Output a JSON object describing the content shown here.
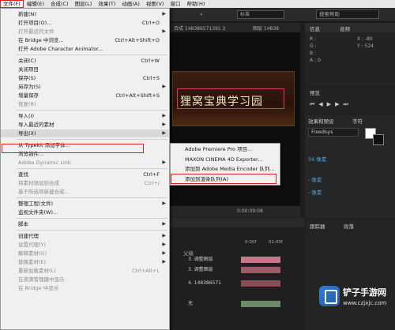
{
  "menubar": {
    "items": [
      "文件(F)",
      "编辑(E)",
      "合成(C)",
      "图层(L)",
      "效果(T)",
      "动画(A)",
      "视图(V)",
      "窗口",
      "帮助(H)"
    ]
  },
  "toolbar": {
    "std_label": "标准",
    "search_help": "搜索帮助"
  },
  "comp": {
    "tab1": "合成 148386571391 2",
    "tab2": "图层 14838",
    "title_text": "狸窝宝典学习园",
    "timecode": "0:00:09:08"
  },
  "info": {
    "tab_info": "信息",
    "tab_audio": "音频",
    "r": "R :",
    "g": "G :",
    "b": "B :",
    "a": "A : 0",
    "x": "X : -80",
    "y": "Y : 524"
  },
  "preview": {
    "title": "预览"
  },
  "effects": {
    "tab_effects": "效果和预设",
    "tab_char": "字符",
    "font": "Fixedsys",
    "size1": "56 像素",
    "size2": "- 像素",
    "size3": "- 像素"
  },
  "paragraph": {
    "tab1": "跟踪器",
    "tab2": "段落"
  },
  "timeline": {
    "col": "父级",
    "tracks": [
      "3. 调整图层",
      "3. 调整图层",
      "4. 148386571",
      "无"
    ],
    "markers": [
      "0:00f",
      "01:00f"
    ]
  },
  "file_menu": {
    "items": [
      {
        "label": "新建(N)",
        "shortcut": "",
        "arrow": true,
        "disabled": false
      },
      {
        "label": "打开项目(O)...",
        "shortcut": "Ctrl+O",
        "arrow": false,
        "disabled": false
      },
      {
        "label": "打开最近的文件",
        "shortcut": "",
        "arrow": true,
        "disabled": true
      },
      {
        "label": "在 Bridge 中浏览...",
        "shortcut": "Ctrl+Alt+Shift+O",
        "arrow": false,
        "disabled": false
      },
      {
        "label": "打开 Adobe Character Animator...",
        "shortcut": "",
        "arrow": false,
        "disabled": false
      },
      {
        "label": "关闭(C)",
        "shortcut": "Ctrl+W",
        "arrow": false,
        "disabled": false
      },
      {
        "label": "关闭项目",
        "shortcut": "",
        "arrow": false,
        "disabled": false
      },
      {
        "label": "保存(S)",
        "shortcut": "Ctrl+S",
        "arrow": false,
        "disabled": false
      },
      {
        "label": "另存为(S)",
        "shortcut": "",
        "arrow": true,
        "disabled": false
      },
      {
        "label": "增量保存",
        "shortcut": "Ctrl+Alt+Shift+S",
        "arrow": false,
        "disabled": false
      },
      {
        "label": "恢复(R)",
        "shortcut": "",
        "arrow": false,
        "disabled": true
      },
      {
        "label": "导入(I)",
        "shortcut": "",
        "arrow": true,
        "disabled": false
      },
      {
        "label": "导入最近的素材",
        "shortcut": "",
        "arrow": true,
        "disabled": false
      },
      {
        "label": "导出(X)",
        "shortcut": "",
        "arrow": true,
        "disabled": false
      },
      {
        "label": "从 Typekit 添加字体...",
        "shortcut": "",
        "arrow": false,
        "disabled": false
      },
      {
        "label": "浏览插件...",
        "shortcut": "",
        "arrow": false,
        "disabled": false
      },
      {
        "label": "Adobe Dynamic Link",
        "shortcut": "",
        "arrow": true,
        "disabled": true
      },
      {
        "label": "查找",
        "shortcut": "Ctrl+F",
        "arrow": false,
        "disabled": false
      },
      {
        "label": "将素材添加到合成",
        "shortcut": "Ctrl+/",
        "arrow": false,
        "disabled": true
      },
      {
        "label": "基于所选项新建合成...",
        "shortcut": "",
        "arrow": false,
        "disabled": true
      },
      {
        "label": "整理工程(文件)",
        "shortcut": "",
        "arrow": true,
        "disabled": false
      },
      {
        "label": "监视文件夹(W)...",
        "shortcut": "",
        "arrow": false,
        "disabled": false
      },
      {
        "label": "脚本",
        "shortcut": "",
        "arrow": true,
        "disabled": false
      },
      {
        "label": "创建代理",
        "shortcut": "",
        "arrow": true,
        "disabled": false
      },
      {
        "label": "设置代理(Y)",
        "shortcut": "",
        "arrow": true,
        "disabled": true
      },
      {
        "label": "解释素材(G)",
        "shortcut": "",
        "arrow": true,
        "disabled": true
      },
      {
        "label": "替换素材(E)",
        "shortcut": "",
        "arrow": true,
        "disabled": true
      },
      {
        "label": "重新加载素材(L)",
        "shortcut": "Ctrl+Alt+L",
        "arrow": false,
        "disabled": true
      },
      {
        "label": "在资源管理器中显示",
        "shortcut": "",
        "arrow": false,
        "disabled": true
      },
      {
        "label": "在 Bridge 中显示",
        "shortcut": "",
        "arrow": false,
        "disabled": true
      }
    ]
  },
  "export_submenu": {
    "items": [
      "Adobe Premiere Pro 项目...",
      "MAXON CINEMA 4D Exporter...",
      "添加到 Adobe Media Encoder 队列...",
      "添加到渲染队列(A)"
    ]
  },
  "watermark": {
    "title": "铲子手游网",
    "url": "www.czjxjc.com"
  }
}
